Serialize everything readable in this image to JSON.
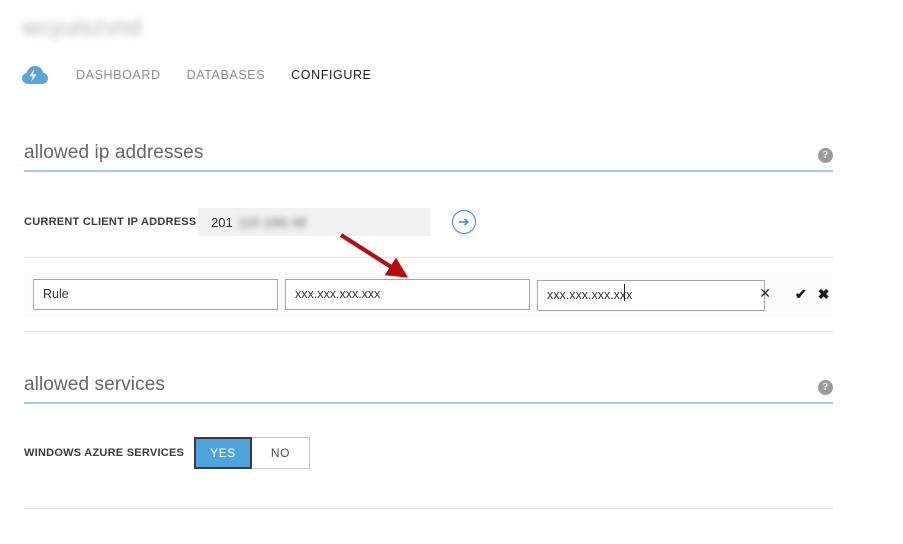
{
  "header": {
    "server_title": "wcyuiszvnd",
    "server_title_redacted": true,
    "nav_icon": "azure-sql-database-icon",
    "nav_items": [
      {
        "label": "DASHBOARD",
        "active": false
      },
      {
        "label": "DATABASES",
        "active": false
      },
      {
        "label": "CONFIGURE",
        "active": true
      }
    ]
  },
  "sections": {
    "allowed_ip": {
      "title": "allowed ip addresses",
      "help_icon": "question-mark-icon",
      "help_glyph": "?",
      "current_ip": {
        "label": "CURRENT CLIENT IP ADDRESS",
        "value_visible": "201",
        "value_redacted": ".110.188.48",
        "add_button_icon": "arrow-right-circle-icon",
        "add_button_glyph": "→"
      },
      "rule_row": {
        "name_placeholder": "Rule",
        "name_value": "",
        "start_ip_placeholder": "xxx.xxx.xxx.xxx",
        "start_ip_value": "",
        "end_ip_value": "xxx.xxx.xxx.xxx",
        "clear_icon": "close-icon",
        "clear_glyph": "✕",
        "confirm_icon": "checkmark-icon",
        "confirm_glyph": "✔",
        "cancel_icon": "close-icon",
        "cancel_glyph": "✖"
      }
    },
    "allowed_services": {
      "title": "allowed services",
      "help_icon": "question-mark-icon",
      "help_glyph": "?",
      "azure_services": {
        "label": "WINDOWS AZURE SERVICES",
        "yes_label": "YES",
        "no_label": "NO",
        "selected": "YES"
      }
    }
  },
  "annotation": {
    "type": "arrow",
    "color": "#b60d0d",
    "points_to": "rule-start-ip-input"
  },
  "colors": {
    "accent_blue": "#4ea3dd",
    "section_underline": "#a8cbe8",
    "annotation_red": "#b60d0d",
    "field_background": "#f1f1f1",
    "text_primary": "#333333",
    "text_muted": "#8c8c8c"
  }
}
